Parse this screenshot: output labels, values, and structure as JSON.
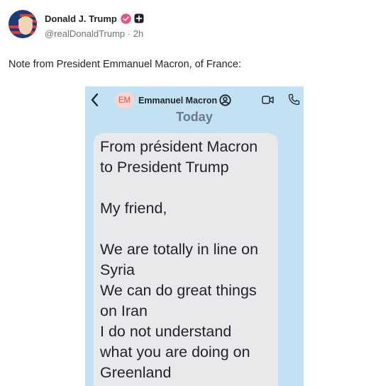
{
  "post": {
    "display_name": "Donald J. Trump",
    "handle": "@realDonaldTrump",
    "separator": "·",
    "time_ago": "2h",
    "text": "Note from President Emmanuel Macron, of France:",
    "icons": {
      "verified": "verified-badge-icon",
      "platform": "plus-square-icon"
    }
  },
  "media": {
    "chat_header": {
      "avatar_initials": "EM",
      "contact_name": "Emmanuel Macron",
      "icons": [
        "back-chevron-icon",
        "contact-card-icon",
        "video-call-icon",
        "phone-call-icon"
      ]
    },
    "day_label": "Today",
    "message_lines": [
      "From président Macron",
      "to President Trump",
      "",
      "My friend,",
      "",
      "We are totally in line on",
      "Syria",
      "We can do great things",
      "on Iran",
      "I do not understand",
      "what you are doing on",
      "Greenland"
    ]
  },
  "colors": {
    "chat_background": "#c2e2f4",
    "bubble": "#e9e9eb",
    "verified_badge": "#e5557f",
    "avatar_initials": "#d9534f"
  }
}
